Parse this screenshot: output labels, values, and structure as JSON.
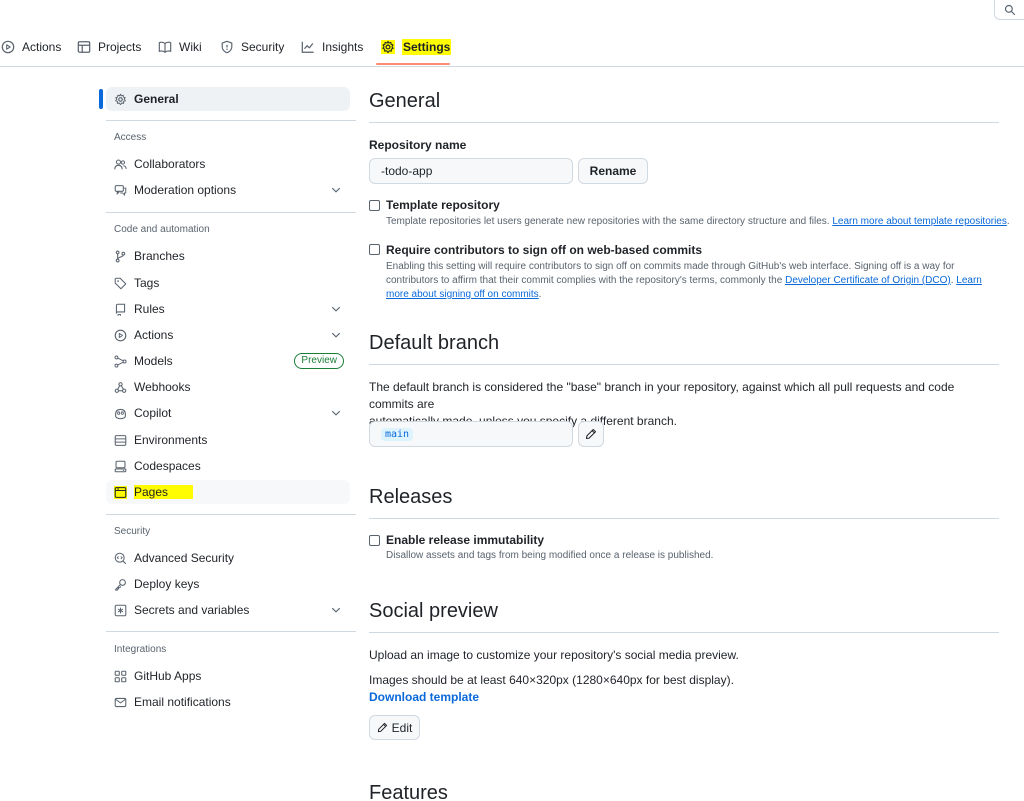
{
  "topnav": {
    "tabs": [
      {
        "label": "Actions",
        "icon": "play-circle-icon"
      },
      {
        "label": "Projects",
        "icon": "table-icon"
      },
      {
        "label": "Wiki",
        "icon": "book-icon"
      },
      {
        "label": "Security",
        "icon": "shield-icon"
      },
      {
        "label": "Insights",
        "icon": "graph-icon"
      },
      {
        "label": "Settings",
        "icon": "gear-icon",
        "active": true
      }
    ],
    "active_underline_color": "#fd8c73",
    "highlight_color": "#fffb00"
  },
  "sidebar": {
    "general": "General",
    "sections": {
      "access": "Access",
      "code_automation": "Code and automation",
      "security": "Security",
      "integrations": "Integrations"
    },
    "items": {
      "collaborators": "Collaborators",
      "moderation": "Moderation options",
      "branches": "Branches",
      "tags": "Tags",
      "rules": "Rules",
      "actions": "Actions",
      "models": "Models",
      "models_badge": "Preview",
      "webhooks": "Webhooks",
      "copilot": "Copilot",
      "environments": "Environments",
      "codespaces": "Codespaces",
      "pages": "Pages",
      "advanced_security": "Advanced Security",
      "deploy_keys": "Deploy keys",
      "secrets": "Secrets and variables",
      "github_apps": "GitHub Apps",
      "email_notifications": "Email notifications"
    }
  },
  "main": {
    "general_title": "General",
    "repo_name_label": "Repository name",
    "repo_name_value": "-todo-app",
    "rename_button": "Rename",
    "template": {
      "label": "Template repository",
      "desc": "Template repositories let users generate new repositories with the same directory structure and files.",
      "link": "Learn more about template repositories",
      "end": "."
    },
    "signoff": {
      "label": "Require contributors to sign off on web-based commits",
      "desc_line1": "Enabling this setting will require contributors to sign off on commits made through GitHub's web interface. Signing off is a way for",
      "desc_line2": "contributors to affirm that their commit complies with the repository's terms, commonly the",
      "link1": "Developer Certificate of Origin (DCO)",
      "sep": ".",
      "link2a": "Learn",
      "link2b": "more about signing off on commits",
      "end": "."
    },
    "default_branch": {
      "title": "Default branch",
      "desc_line1": "The default branch is considered the \"base\" branch in your repository, against which all pull requests and code commits are",
      "desc_line2": "automatically made, unless you specify a different branch.",
      "branch": "main"
    },
    "releases": {
      "title": "Releases",
      "label": "Enable release immutability",
      "desc": "Disallow assets and tags from being modified once a release is published."
    },
    "social": {
      "title": "Social preview",
      "line1": "Upload an image to customize your repository's social media preview.",
      "line2": "Images should be at least 640×320px (1280×640px for best display).",
      "download": "Download template",
      "edit": "Edit"
    },
    "features_title": "Features"
  }
}
